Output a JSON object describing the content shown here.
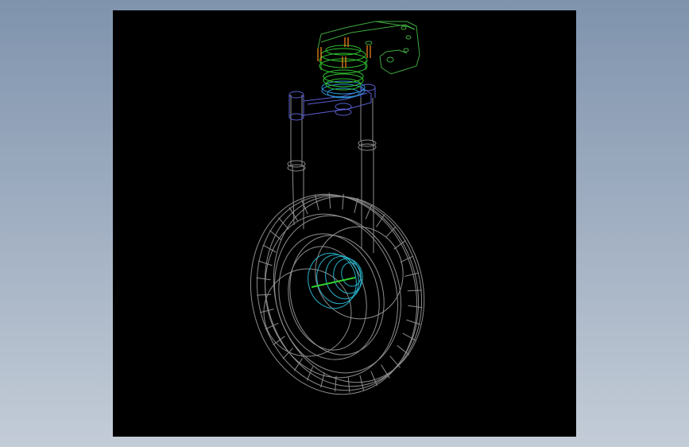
{
  "scene": {
    "subject": "caster-wheel-assembly",
    "display_style": "wireframe",
    "colors": {
      "app_background_top": "#7f93ad",
      "app_background_bottom": "#c3ccd7",
      "viewport_background": "#000000",
      "wheel": "#8c8c8c",
      "fork": "#8c8c8c",
      "plate": "#3fa83f",
      "bearing_upper": "#2fbf2f",
      "bearing_lower": "#2a8fd0",
      "arm": "#5a5fd0",
      "bolts": "#ff8c1a",
      "axle": "#2fd02f",
      "hub_detail": "#27b0c8"
    }
  }
}
